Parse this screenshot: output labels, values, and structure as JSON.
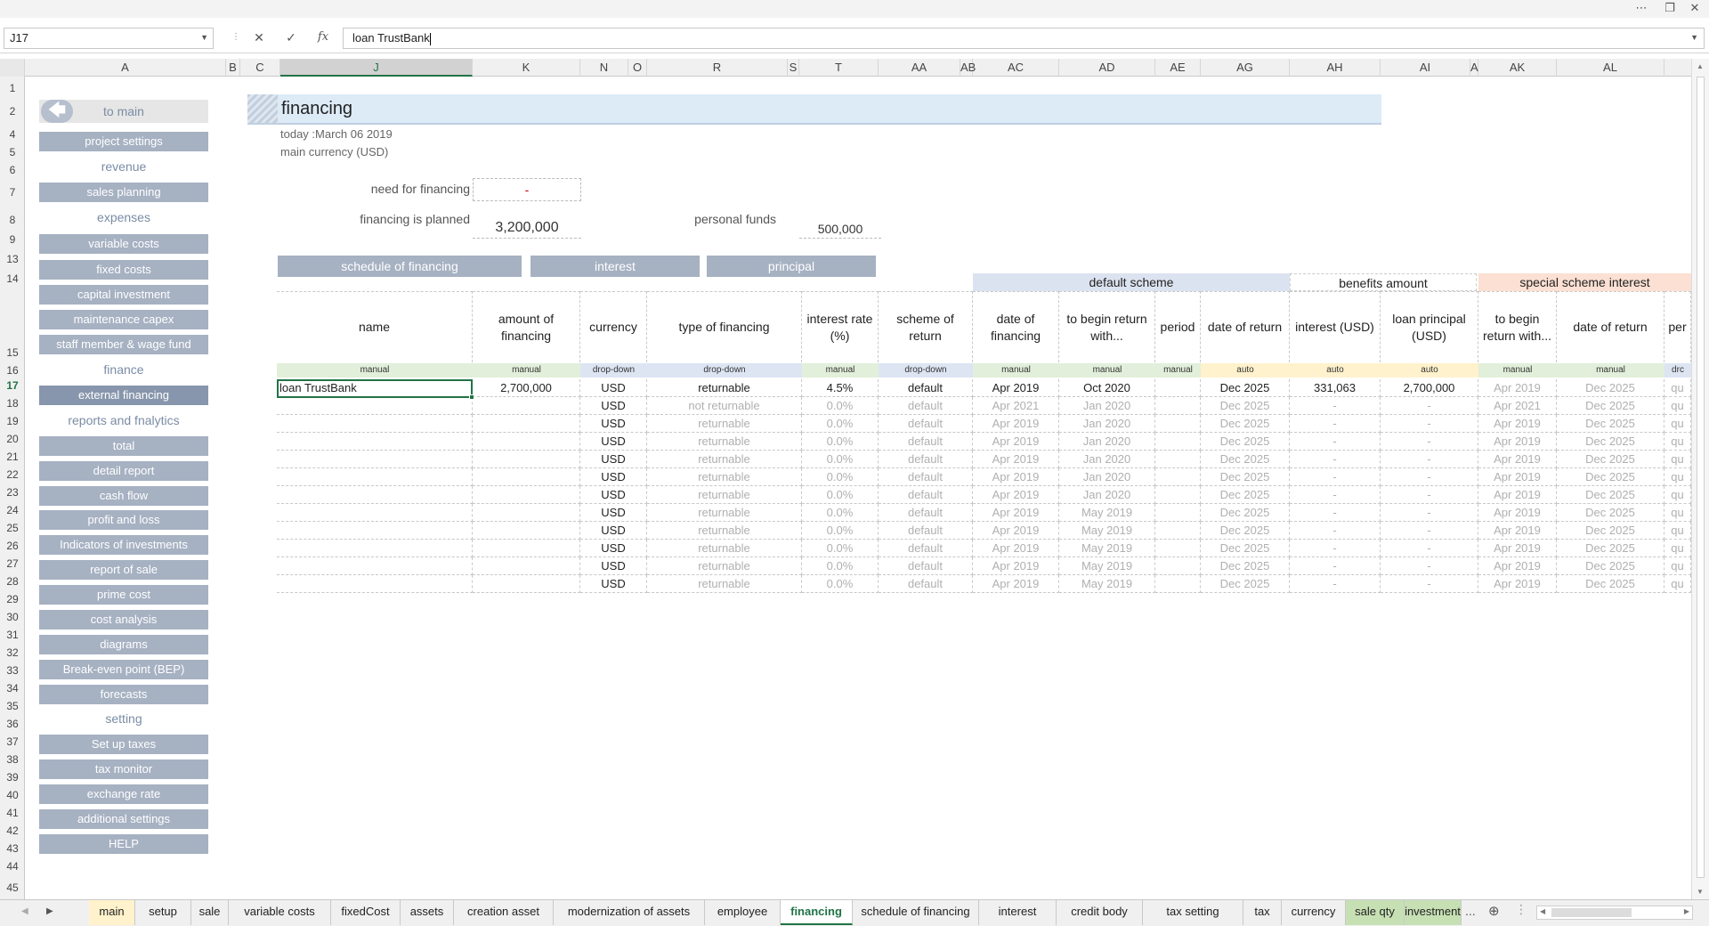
{
  "formula_bar": {
    "name_box": "J17",
    "cancel_icon": "✕",
    "enter_icon": "✓",
    "fx_label": "fx",
    "content": "loan TrustBank"
  },
  "columns": [
    "A",
    "B",
    "C",
    "J",
    "K",
    "N",
    "O",
    "R",
    "S",
    "T",
    "AA",
    "AB",
    "AC",
    "AD",
    "AE",
    "AG",
    "AH",
    "AI",
    "A",
    "AK",
    "AL"
  ],
  "rows": [
    "1",
    "2",
    "4",
    "5",
    "6",
    "7",
    "8",
    "9",
    "13",
    "14",
    "15",
    "16",
    "17",
    "18",
    "19",
    "20",
    "21",
    "22",
    "23",
    "24",
    "25",
    "26",
    "27",
    "28",
    "29",
    "30",
    "31",
    "32",
    "33",
    "34",
    "35",
    "36",
    "37",
    "38",
    "39",
    "40",
    "41",
    "42",
    "43",
    "44",
    "45"
  ],
  "sidebar": {
    "to_main": "to main",
    "items": [
      {
        "type": "button",
        "label": "project settings"
      },
      {
        "type": "section",
        "label": "revenue"
      },
      {
        "type": "button",
        "label": "sales planning"
      },
      {
        "type": "section",
        "label": "expenses"
      },
      {
        "type": "button",
        "label": "variable costs"
      },
      {
        "type": "button",
        "label": "fixed costs"
      },
      {
        "type": "button",
        "label": "capital investment"
      },
      {
        "type": "button",
        "label": "maintenance capex"
      },
      {
        "type": "button",
        "label": "staff member & wage fund"
      },
      {
        "type": "section",
        "label": "finance"
      },
      {
        "type": "button",
        "label": "external financing",
        "active": true
      },
      {
        "type": "section",
        "label": "reports and fnalytics"
      },
      {
        "type": "button",
        "label": "total"
      },
      {
        "type": "button",
        "label": "detail report"
      },
      {
        "type": "button",
        "label": "cash flow"
      },
      {
        "type": "button",
        "label": "profit and loss"
      },
      {
        "type": "button",
        "label": "Indicators of investments"
      },
      {
        "type": "button",
        "label": "report of sale"
      },
      {
        "type": "button",
        "label": "prime cost"
      },
      {
        "type": "button",
        "label": "cost analysis"
      },
      {
        "type": "button",
        "label": "diagrams"
      },
      {
        "type": "button",
        "label": "Break-even point (BEP)"
      },
      {
        "type": "button",
        "label": "forecasts"
      },
      {
        "type": "section",
        "label": "setting"
      },
      {
        "type": "button",
        "label": "Set up taxes"
      },
      {
        "type": "button",
        "label": "tax monitor"
      },
      {
        "type": "button",
        "label": "exchange rate"
      },
      {
        "type": "button",
        "label": "additional settings"
      },
      {
        "type": "button",
        "label": "HELP"
      }
    ]
  },
  "header": {
    "title": "financing",
    "today": "today :March 06 2019",
    "currency": "main currency (USD)",
    "need_label": "need for financing",
    "need_value": "-",
    "planned_label": "financing is planned",
    "planned_value": "3,200,000",
    "personal_label": "personal funds",
    "personal_value": "500,000"
  },
  "action_buttons": [
    "schedule of financing",
    "interest",
    "principal"
  ],
  "table": {
    "groups": [
      "default scheme",
      "benefits amount",
      "special scheme interest"
    ],
    "headers": [
      "name",
      "amount of financing",
      "currency",
      "type of financing",
      "interest rate (%)",
      "scheme of return",
      "date of financing",
      "to begin return with...",
      "period",
      "date of return",
      "interest (USD)",
      "loan principal (USD)",
      "to begin return with...",
      "date of return",
      "per"
    ],
    "input_types": [
      "manual",
      "manual",
      "drop-down",
      "drop-down",
      "manual",
      "drop-down",
      "manual",
      "manual",
      "manual",
      "auto",
      "auto",
      "auto",
      "manual",
      "manual",
      "drc"
    ],
    "rows": [
      [
        "loan TrustBank",
        "2,700,000",
        "USD",
        "returnable",
        "4.5%",
        "default",
        "Apr 2019",
        "Oct 2020",
        "",
        "Dec 2025",
        "331,063",
        "2,700,000",
        "Apr 2019",
        "Dec 2025",
        "qu"
      ],
      [
        "",
        "",
        "USD",
        "not returnable",
        "0.0%",
        "default",
        "Apr 2021",
        "Jan 2020",
        "",
        "Dec 2025",
        "-",
        "-",
        "Apr 2021",
        "Dec 2025",
        "qu"
      ],
      [
        "",
        "",
        "USD",
        "returnable",
        "0.0%",
        "default",
        "Apr 2019",
        "Jan 2020",
        "",
        "Dec 2025",
        "-",
        "-",
        "Apr 2019",
        "Dec 2025",
        "qu"
      ],
      [
        "",
        "",
        "USD",
        "returnable",
        "0.0%",
        "default",
        "Apr 2019",
        "Jan 2020",
        "",
        "Dec 2025",
        "-",
        "-",
        "Apr 2019",
        "Dec 2025",
        "qu"
      ],
      [
        "",
        "",
        "USD",
        "returnable",
        "0.0%",
        "default",
        "Apr 2019",
        "Jan 2020",
        "",
        "Dec 2025",
        "-",
        "-",
        "Apr 2019",
        "Dec 2025",
        "qu"
      ],
      [
        "",
        "",
        "USD",
        "returnable",
        "0.0%",
        "default",
        "Apr 2019",
        "Jan 2020",
        "",
        "Dec 2025",
        "-",
        "-",
        "Apr 2019",
        "Dec 2025",
        "qu"
      ],
      [
        "",
        "",
        "USD",
        "returnable",
        "0.0%",
        "default",
        "Apr 2019",
        "Jan 2020",
        "",
        "Dec 2025",
        "-",
        "-",
        "Apr 2019",
        "Dec 2025",
        "qu"
      ],
      [
        "",
        "",
        "USD",
        "returnable",
        "0.0%",
        "default",
        "Apr 2019",
        "May 2019",
        "",
        "Dec 2025",
        "-",
        "-",
        "Apr 2019",
        "Dec 2025",
        "qu"
      ],
      [
        "",
        "",
        "USD",
        "returnable",
        "0.0%",
        "default",
        "Apr 2019",
        "May 2019",
        "",
        "Dec 2025",
        "-",
        "-",
        "Apr 2019",
        "Dec 2025",
        "qu"
      ],
      [
        "",
        "",
        "USD",
        "returnable",
        "0.0%",
        "default",
        "Apr 2019",
        "May 2019",
        "",
        "Dec 2025",
        "-",
        "-",
        "Apr 2019",
        "Dec 2025",
        "qu"
      ],
      [
        "",
        "",
        "USD",
        "returnable",
        "0.0%",
        "default",
        "Apr 2019",
        "May 2019",
        "",
        "Dec 2025",
        "-",
        "-",
        "Apr 2019",
        "Dec 2025",
        "qu"
      ],
      [
        "",
        "",
        "USD",
        "returnable",
        "0.0%",
        "default",
        "Apr 2019",
        "May 2019",
        "",
        "Dec 2025",
        "-",
        "-",
        "Apr 2019",
        "Dec 2025",
        "qu"
      ]
    ]
  },
  "sheet_tabs": [
    "main",
    "setup",
    "sale",
    "variable costs",
    "fixedCost",
    "assets",
    "creation asset",
    "modernization of assets",
    "employee",
    "financing",
    "schedule of financing",
    "interest",
    "credit body",
    "tax setting",
    "tax",
    "currency",
    "sale qty",
    "investment"
  ],
  "active_tab": "financing",
  "tabs_more": "...",
  "colors": {
    "accent": "#217346",
    "nav_button": "#a6b1c2",
    "title_band": "#ddebf7"
  }
}
